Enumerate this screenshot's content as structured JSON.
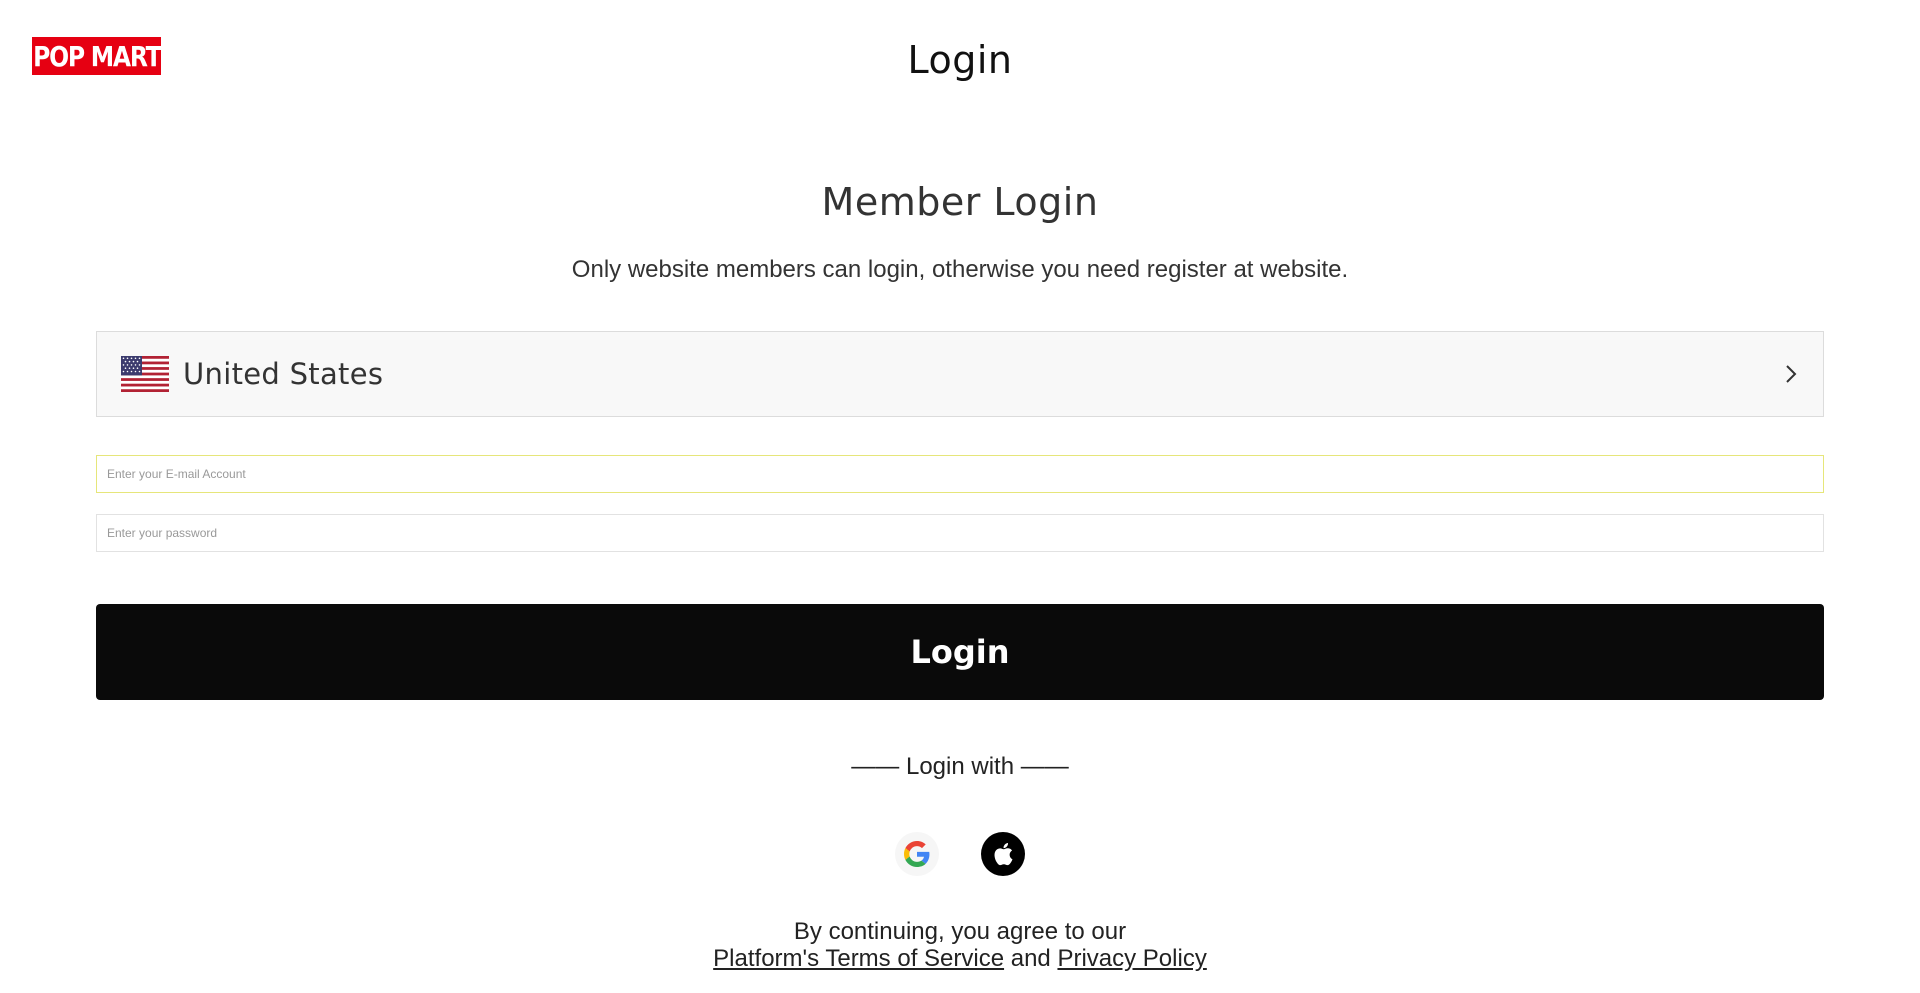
{
  "header": {
    "logo_text": "POP MART",
    "title": "Login"
  },
  "main": {
    "heading": "Member Login",
    "subtitle": "Only website members can login, otherwise you need register at website.",
    "country": {
      "name": "United States",
      "flag_icon": "us-flag-icon"
    },
    "email": {
      "value": "",
      "placeholder": "Enter your E-mail Account"
    },
    "password": {
      "value": "",
      "placeholder": "Enter your password"
    },
    "login_button_label": "Login",
    "login_with_label": "—— Login with ——",
    "social": [
      {
        "icon": "google-icon"
      },
      {
        "icon": "apple-icon"
      }
    ],
    "terms": {
      "prefix": "By continuing, you agree to our",
      "terms_link": "Platform's Terms of Service",
      "conjunction": "and",
      "privacy_link": "Privacy Policy"
    }
  },
  "colors": {
    "logo_bg": "#e60012",
    "logo_text": "#ffffff",
    "button_bg": "#0a0a0a",
    "email_focus_border": "#e6e67a"
  }
}
